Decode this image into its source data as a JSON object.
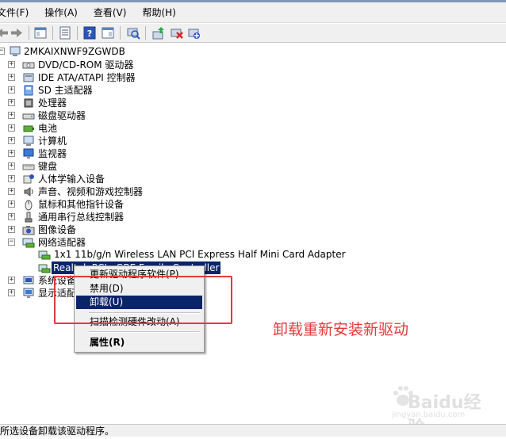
{
  "menubar": {
    "items": [
      "文件(F)",
      "操作(A)",
      "查看(V)",
      "帮助(H)"
    ]
  },
  "tree": {
    "root": "2MKAIXNWF9ZGWDB",
    "categories": [
      "DVD/CD-ROM 驱动器",
      "IDE ATA/ATAPI 控制器",
      "SD 主适配器",
      "处理器",
      "磁盘驱动器",
      "电池",
      "计算机",
      "监视器",
      "键盘",
      "人体学输入设备",
      "声音、视频和游戏控制器",
      "鼠标和其他指针设备",
      "通用串行总线控制器",
      "图像设备",
      "网络适配器"
    ],
    "network_children": [
      "1x1 11b/g/n Wireless LAN PCI Express Half Mini Card Adapter",
      "Realtek PCIe GBE Family Controller"
    ],
    "after": [
      "系统设备",
      "显示适配器"
    ]
  },
  "context_menu": {
    "update": "更新驱动程序软件(P)...",
    "disable": "禁用(D)",
    "uninstall": "卸载(U)",
    "scan": "扫描检测硬件改动(A)",
    "properties": "属性(R)"
  },
  "annotation": "卸载重新安装新驱动",
  "watermark": {
    "brand": "Baidu经验",
    "url": "jingyan.baidu.com"
  },
  "statusbar": {
    "text": "所选设备卸载该驱动程序。"
  },
  "colors": {
    "annotation_red": "#e5393b",
    "selection": "#0a246a"
  }
}
